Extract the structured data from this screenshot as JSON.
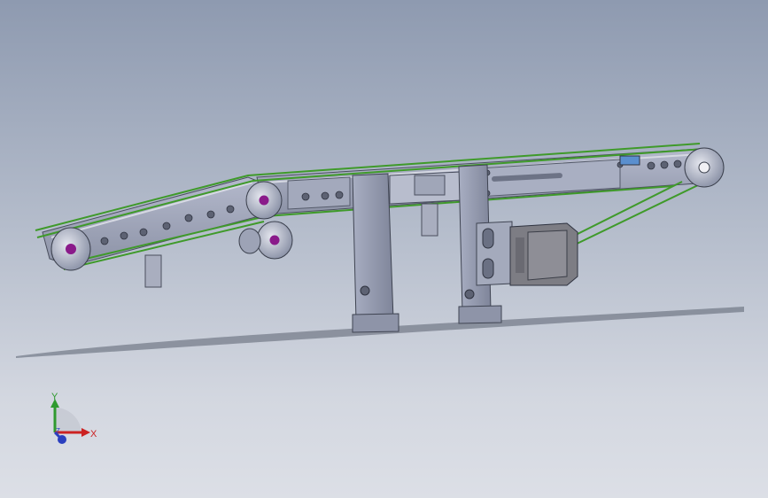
{
  "viewport": {
    "background_top": "#8e9ab0",
    "background_bottom": "#dcdfe6"
  },
  "model": {
    "frame_color": "#9ea4b8",
    "belt_color": "#3f9a2a",
    "roller_hub_color": "#8a1a8a",
    "motor_color": "#7d7d84"
  },
  "triad": {
    "x_label": "X",
    "y_label": "Y",
    "z_label": "Z",
    "x_color": "#cc2222",
    "y_color": "#2f9a2f",
    "z_color": "#2a3fbf"
  }
}
